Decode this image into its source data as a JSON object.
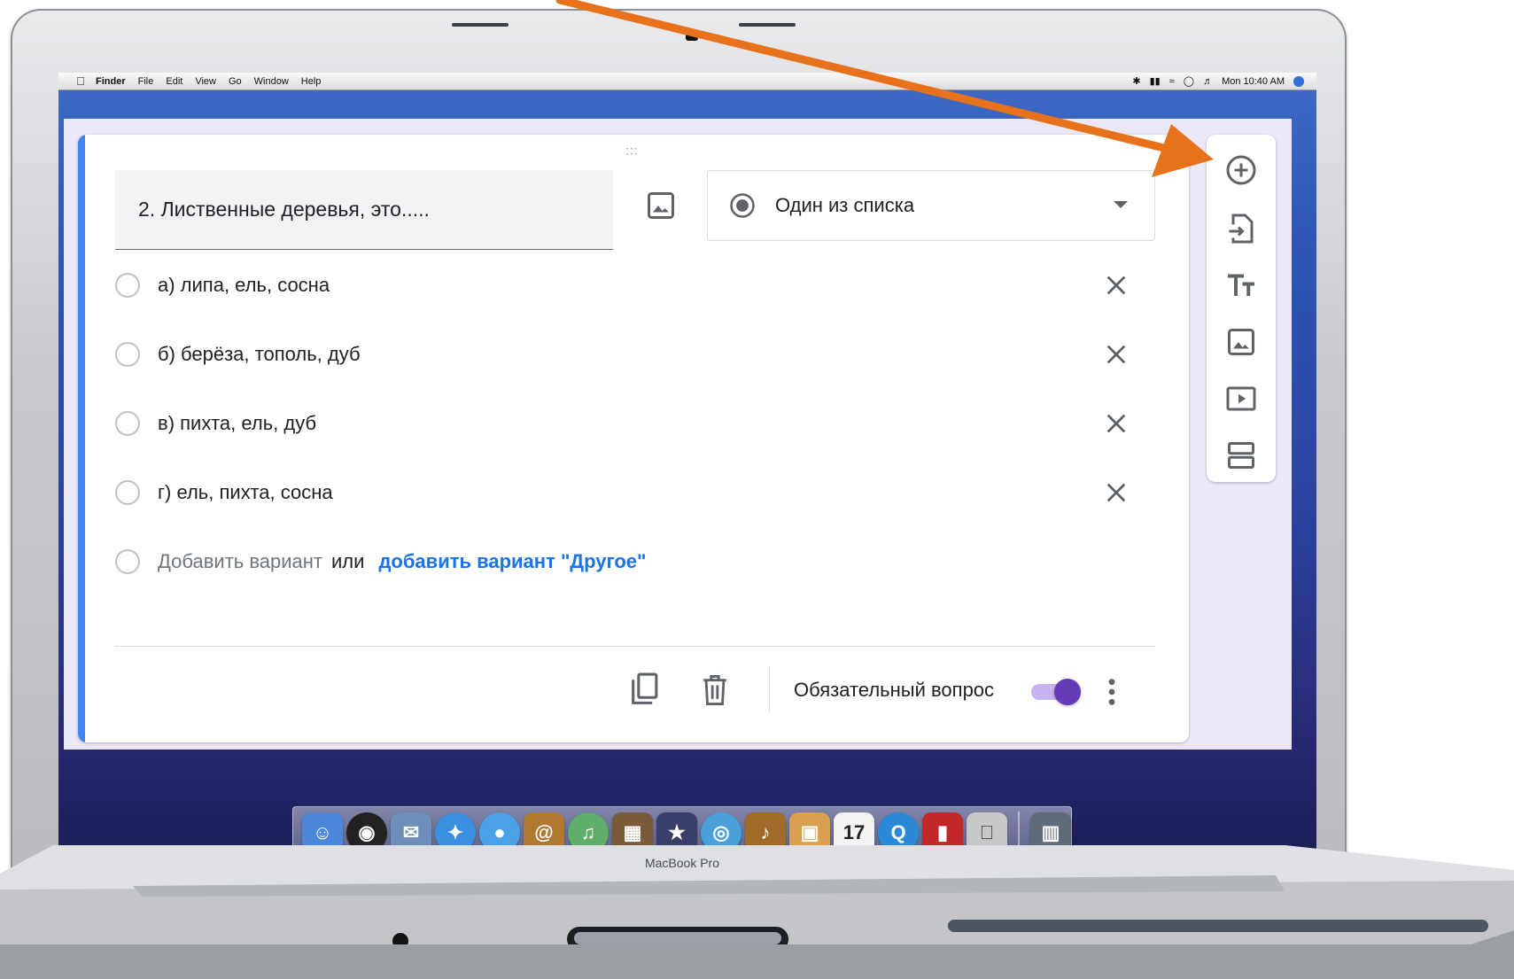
{
  "menubar": {
    "items": [
      "Finder",
      "File",
      "Edit",
      "View",
      "Go",
      "Window",
      "Help"
    ],
    "clock": "Mon 10:40 AM"
  },
  "question": {
    "title": "2. Лиственные деревья, это.....",
    "type_label": "Один из списка",
    "options": [
      "а) липа, ель, сосна",
      "б) берёза, тополь, дуб",
      "в) пихта, ель, дуб",
      "г) ель, пихта, сосна"
    ],
    "add_option": "Добавить вариант",
    "or_text": "или",
    "add_other": "добавить вариант \"Другое\"",
    "required_label": "Обязательный вопрос",
    "required": true
  },
  "toolbar": {
    "icons": [
      "add-question-icon",
      "import-question-icon",
      "add-title-icon",
      "add-image-icon",
      "add-video-icon",
      "add-section-icon"
    ]
  },
  "dock": {
    "icons": [
      "finder-icon",
      "dashboard-icon",
      "mail-icon",
      "safari-icon",
      "ichat-icon",
      "address-book-icon",
      "itunes-icon",
      "iphoto-icon",
      "imovie-icon",
      "idvd-icon",
      "garageband-icon",
      "iweb-icon",
      "ical-icon",
      "quicktime-icon",
      "photo-booth-icon",
      "system-preferences-icon",
      "trash-icon"
    ],
    "calendar_day": "17"
  },
  "device": {
    "brand": "MacBook Pro"
  },
  "colors": {
    "accent_blue": "#4285f4",
    "toggle_purple": "#673ab7",
    "link_blue": "#1a73e8",
    "arrow_orange": "#e8711c"
  }
}
